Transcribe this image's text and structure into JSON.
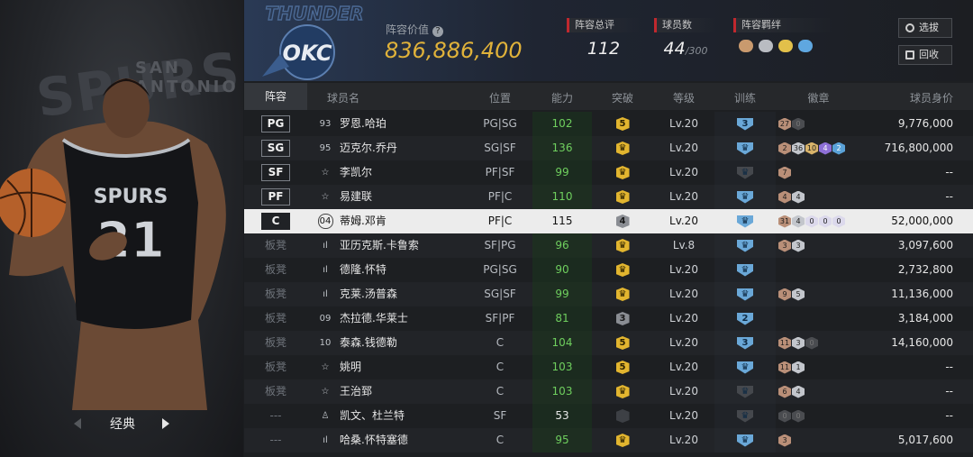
{
  "left_panel": {
    "bg_text": "SPURS",
    "bg_text_small": "SAN ANTONIO",
    "jersey_team": "SPURS",
    "jersey_number": "21",
    "nav_label": "经典"
  },
  "header": {
    "team_logo_text": "OKC",
    "team_logo_top": "THUNDER",
    "lineup_value_label": "阵容价值",
    "lineup_value": "836,886,400",
    "rating_label": "阵容总评",
    "rating_value": "112",
    "players_label": "球员数",
    "players_value": "44",
    "players_max": "/300",
    "bond_label": "阵容羁绊",
    "bond_colors": [
      "#c99a6e",
      "#b9bcc2",
      "#e2c04a",
      "#5fa7e0"
    ],
    "select_button": "选拔",
    "recycle_button": "回收"
  },
  "columns": {
    "lineup": "阵容",
    "name": "球员名",
    "position": "位置",
    "ability": "能力",
    "breakthrough": "突破",
    "level": "等级",
    "training": "训练",
    "badges": "徽章",
    "value": "球员身价"
  },
  "players": [
    {
      "slot": "PG",
      "icon": "93",
      "name": "罗恩.哈珀",
      "pos": "PG|SG",
      "ovr": "102",
      "brk": "5",
      "brk_style": "gold",
      "lvl": "Lv.20",
      "tr": "3",
      "tr_style": "blue",
      "badges": [
        {
          "t": "27",
          "c": "bronze"
        },
        {
          "t": "0",
          "c": "dark"
        }
      ],
      "value": "9,776,000"
    },
    {
      "slot": "SG",
      "icon": "95",
      "name": "迈克尔.乔丹",
      "pos": "SG|SF",
      "ovr": "136",
      "brk": "♛",
      "brk_style": "gold",
      "lvl": "Lv.20",
      "tr": "♛",
      "tr_style": "blue",
      "badges": [
        {
          "t": "2",
          "c": "bronze"
        },
        {
          "t": "36",
          "c": "silver"
        },
        {
          "t": "10",
          "c": "gold"
        },
        {
          "t": "4",
          "c": "purple"
        },
        {
          "t": "2",
          "c": "blue"
        }
      ],
      "value": "716,800,000"
    },
    {
      "slot": "SF",
      "icon": "☆",
      "name": "李凯尔",
      "pos": "PF|SF",
      "ovr": "99",
      "brk": "♛",
      "brk_style": "gold",
      "lvl": "Lv.20",
      "tr": "♛",
      "tr_style": "dark",
      "badges": [
        {
          "t": "7",
          "c": "bronze"
        }
      ],
      "value": "--"
    },
    {
      "slot": "PF",
      "icon": "☆",
      "name": "易建联",
      "pos": "PF|C",
      "ovr": "110",
      "brk": "♛",
      "brk_style": "gold",
      "lvl": "Lv.20",
      "tr": "♛",
      "tr_style": "blue",
      "badges": [
        {
          "t": "4",
          "c": "bronze"
        },
        {
          "t": "4",
          "c": "silver"
        }
      ],
      "value": "--"
    },
    {
      "slot": "C",
      "icon": "04",
      "name": "蒂姆.邓肯",
      "pos": "PF|C",
      "ovr": "115",
      "brk": "4",
      "brk_style": "gray",
      "lvl": "Lv.20",
      "tr": "♛",
      "tr_style": "blue",
      "badges": [
        {
          "t": "31",
          "c": "bronze"
        },
        {
          "t": "4",
          "c": "silver"
        },
        {
          "t": "0",
          "c": "pale"
        },
        {
          "t": "0",
          "c": "pale"
        },
        {
          "t": "0",
          "c": "pale"
        }
      ],
      "value": "52,000,000",
      "selected": true
    },
    {
      "slot": "板凳",
      "icon": "ıl",
      "name": "亚历克斯.卡鲁索",
      "pos": "SF|PG",
      "ovr": "96",
      "brk": "♛",
      "brk_style": "gold",
      "lvl": "Lv.8",
      "tr": "♛",
      "tr_style": "blue",
      "badges": [
        {
          "t": "3",
          "c": "bronze"
        },
        {
          "t": "3",
          "c": "silver"
        }
      ],
      "value": "3,097,600"
    },
    {
      "slot": "板凳",
      "icon": "ıl",
      "name": "德隆.怀特",
      "pos": "PG|SG",
      "ovr": "90",
      "brk": "♛",
      "brk_style": "gold",
      "lvl": "Lv.20",
      "tr": "♛",
      "tr_style": "blue",
      "badges": [],
      "value": "2,732,800"
    },
    {
      "slot": "板凳",
      "icon": "ıl",
      "name": "克莱.汤普森",
      "pos": "SG|SF",
      "ovr": "99",
      "brk": "♛",
      "brk_style": "gold",
      "lvl": "Lv.20",
      "tr": "♛",
      "tr_style": "blue",
      "badges": [
        {
          "t": "9",
          "c": "bronze"
        },
        {
          "t": "5",
          "c": "silver"
        }
      ],
      "value": "11,136,000"
    },
    {
      "slot": "板凳",
      "icon": "09",
      "name": "杰拉德.华莱士",
      "pos": "SF|PF",
      "ovr": "81",
      "brk": "3",
      "brk_style": "gray",
      "lvl": "Lv.20",
      "tr": "2",
      "tr_style": "blue",
      "badges": [],
      "value": "3,184,000"
    },
    {
      "slot": "板凳",
      "icon": "10",
      "name": "泰森.钱德勒",
      "pos": "C",
      "ovr": "104",
      "brk": "5",
      "brk_style": "gold",
      "lvl": "Lv.20",
      "tr": "3",
      "tr_style": "blue",
      "badges": [
        {
          "t": "11",
          "c": "bronze"
        },
        {
          "t": "3",
          "c": "silver"
        },
        {
          "t": "0",
          "c": "dark"
        }
      ],
      "value": "14,160,000"
    },
    {
      "slot": "板凳",
      "icon": "☆",
      "name": "姚明",
      "pos": "C",
      "ovr": "103",
      "brk": "5",
      "brk_style": "gold",
      "lvl": "Lv.20",
      "tr": "♛",
      "tr_style": "blue",
      "badges": [
        {
          "t": "11",
          "c": "bronze"
        },
        {
          "t": "1",
          "c": "silver"
        }
      ],
      "value": "--"
    },
    {
      "slot": "板凳",
      "icon": "☆",
      "name": "王治郅",
      "pos": "C",
      "ovr": "103",
      "brk": "♛",
      "brk_style": "gold",
      "lvl": "Lv.20",
      "tr": "♛",
      "tr_style": "dark",
      "badges": [
        {
          "t": "6",
          "c": "bronze"
        },
        {
          "t": "4",
          "c": "silver"
        }
      ],
      "value": "--"
    },
    {
      "slot": "---",
      "icon": "♙",
      "name": "凯文、杜兰特",
      "pos": "SF",
      "ovr": "53",
      "brk": "-",
      "brk_style": "dark",
      "lvl": "Lv.20",
      "tr": "♛",
      "tr_style": "dark",
      "badges": [
        {
          "t": "0",
          "c": "dark"
        },
        {
          "t": "0",
          "c": "dark"
        }
      ],
      "value": "--",
      "plain_ovr": true
    },
    {
      "slot": "---",
      "icon": "ıl",
      "name": "哈桑.怀特塞德",
      "pos": "C",
      "ovr": "95",
      "brk": "♛",
      "brk_style": "gold",
      "lvl": "Lv.20",
      "tr": "♛",
      "tr_style": "blue",
      "badges": [
        {
          "t": "3",
          "c": "bronze"
        }
      ],
      "value": "5,017,600"
    }
  ]
}
